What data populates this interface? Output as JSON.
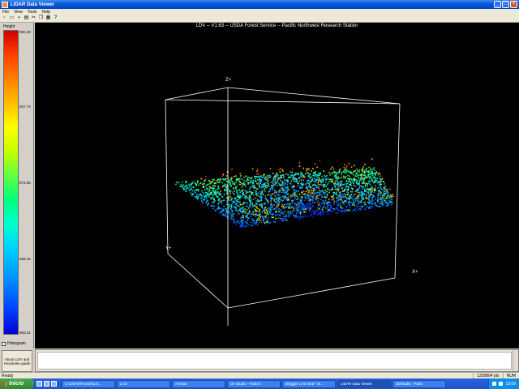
{
  "window": {
    "title": "LIDAR Data Viewer"
  },
  "menu": [
    "File",
    "View",
    "Tools",
    "Help"
  ],
  "toolbar": [
    {
      "icon": "new-file-icon",
      "glyph": "▫"
    },
    {
      "icon": "open-folder-icon",
      "glyph": "▭"
    },
    {
      "icon": "save-icon",
      "glyph": "▪"
    },
    {
      "icon": "print-icon",
      "glyph": "▤"
    },
    {
      "icon": "cut-icon",
      "glyph": "✂"
    },
    {
      "icon": "copy-icon",
      "glyph": "❐"
    },
    {
      "icon": "paste-icon",
      "glyph": "▦"
    },
    {
      "icon": "help-icon",
      "glyph": "?"
    }
  ],
  "legend": {
    "header": "Height",
    "ticks": [
      "982.30",
      "927.74",
      "873.05",
      "868.45",
      "863.01"
    ],
    "histogram_label": "Histogram"
  },
  "about_button": "About LDV and Keystroke guide",
  "viewport": {
    "title": "LDV -- V1.63 -- USDA Forest Service -- Pacific Northwest Research Station",
    "axis_z": "Z+",
    "axis_y": "Y+",
    "axis_x": "X+"
  },
  "status": {
    "text": "Ready",
    "points": "1339804 pts",
    "mode": "NUM"
  },
  "taskbar": {
    "start": "Inicio",
    "tasks": [
      "C:\\LIDAR\\Fusion\\LD...",
      "LAS",
      "Arenas",
      "De Studio - Fusion",
      "Blogger LAS mod - M...",
      "LIDAR Data Viewer",
      "3DStudio - Paint"
    ],
    "clock": "13:09"
  }
}
